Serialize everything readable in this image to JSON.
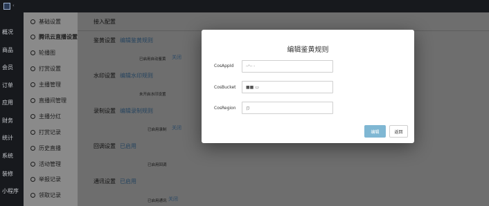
{
  "app": {
    "caret_glyph": "‹"
  },
  "nav": {
    "items": [
      {
        "label": "概况"
      },
      {
        "label": "商品"
      },
      {
        "label": "会员"
      },
      {
        "label": "订单"
      },
      {
        "label": "应用"
      },
      {
        "label": "财务"
      },
      {
        "label": "统计"
      },
      {
        "label": "系统"
      },
      {
        "label": "装修"
      },
      {
        "label": "小程序"
      }
    ]
  },
  "submenu": {
    "items": [
      {
        "label": "基础设置"
      },
      {
        "label": "腾讯云直播设置"
      },
      {
        "label": "轮播图"
      },
      {
        "label": "打赏设置"
      },
      {
        "label": "主播管理"
      },
      {
        "label": "直播间管理"
      },
      {
        "label": "主播分红"
      },
      {
        "label": "打赏记录"
      },
      {
        "label": "历史直播"
      },
      {
        "label": "活动管理"
      },
      {
        "label": "举报记录"
      },
      {
        "label": "领取记录"
      }
    ],
    "active_index": 1
  },
  "content": {
    "title": "接入配置",
    "sections": [
      {
        "label": "鉴黄设置",
        "link": "编辑鉴黄规则",
        "status": "已启用自动鉴黄",
        "action": "关闭"
      },
      {
        "label": "水印设置",
        "link": "编辑水印规则",
        "status": "未开启水印设置",
        "action": ""
      },
      {
        "label": "录制设置",
        "link": "编辑录制规则",
        "status": "已启用录制",
        "action": "关闭"
      },
      {
        "label": "回调设置",
        "link": "已启用",
        "status": "已启用回调",
        "action": ""
      },
      {
        "label": "通讯设置",
        "link": "已启用",
        "status": "已启用通讯",
        "action": "关闭"
      }
    ]
  },
  "modal": {
    "title": "编辑鉴黄规则",
    "fields": [
      {
        "label": "CosAppId",
        "value": "··'·· ·"
      },
      {
        "label": "CosBucket",
        "value": "■■ ▭"
      },
      {
        "label": "CosRegion",
        "value": "卩"
      }
    ],
    "save_label": "编辑",
    "back_label": "返回"
  },
  "colors": {
    "sidebar": "#17191d",
    "overlay_content": "#6e6e6e",
    "link": "#26445f",
    "primary_button": "#7fb7d3"
  }
}
